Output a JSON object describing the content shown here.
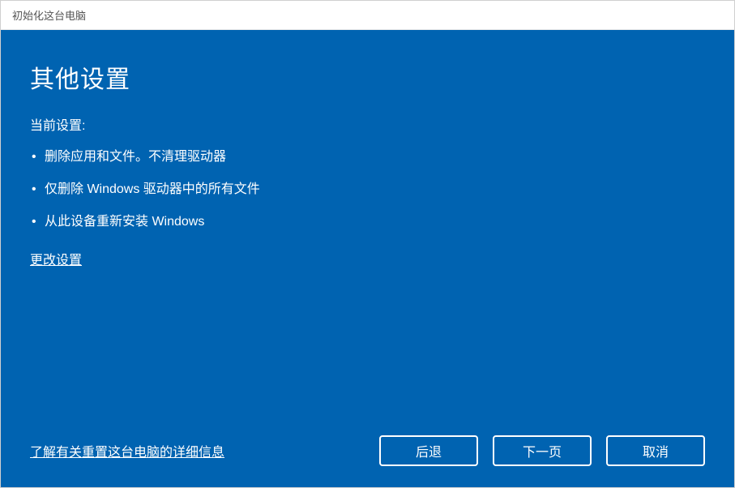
{
  "window": {
    "title": "初始化这台电脑"
  },
  "heading": "其他设置",
  "current_settings_label": "当前设置:",
  "bullets": [
    "删除应用和文件。不清理驱动器",
    "仅删除 Windows 驱动器中的所有文件",
    "从此设备重新安装 Windows"
  ],
  "change_settings_link": "更改设置",
  "learn_more_link": "了解有关重置这台电脑的详细信息",
  "buttons": {
    "back": "后退",
    "next": "下一页",
    "cancel": "取消"
  }
}
